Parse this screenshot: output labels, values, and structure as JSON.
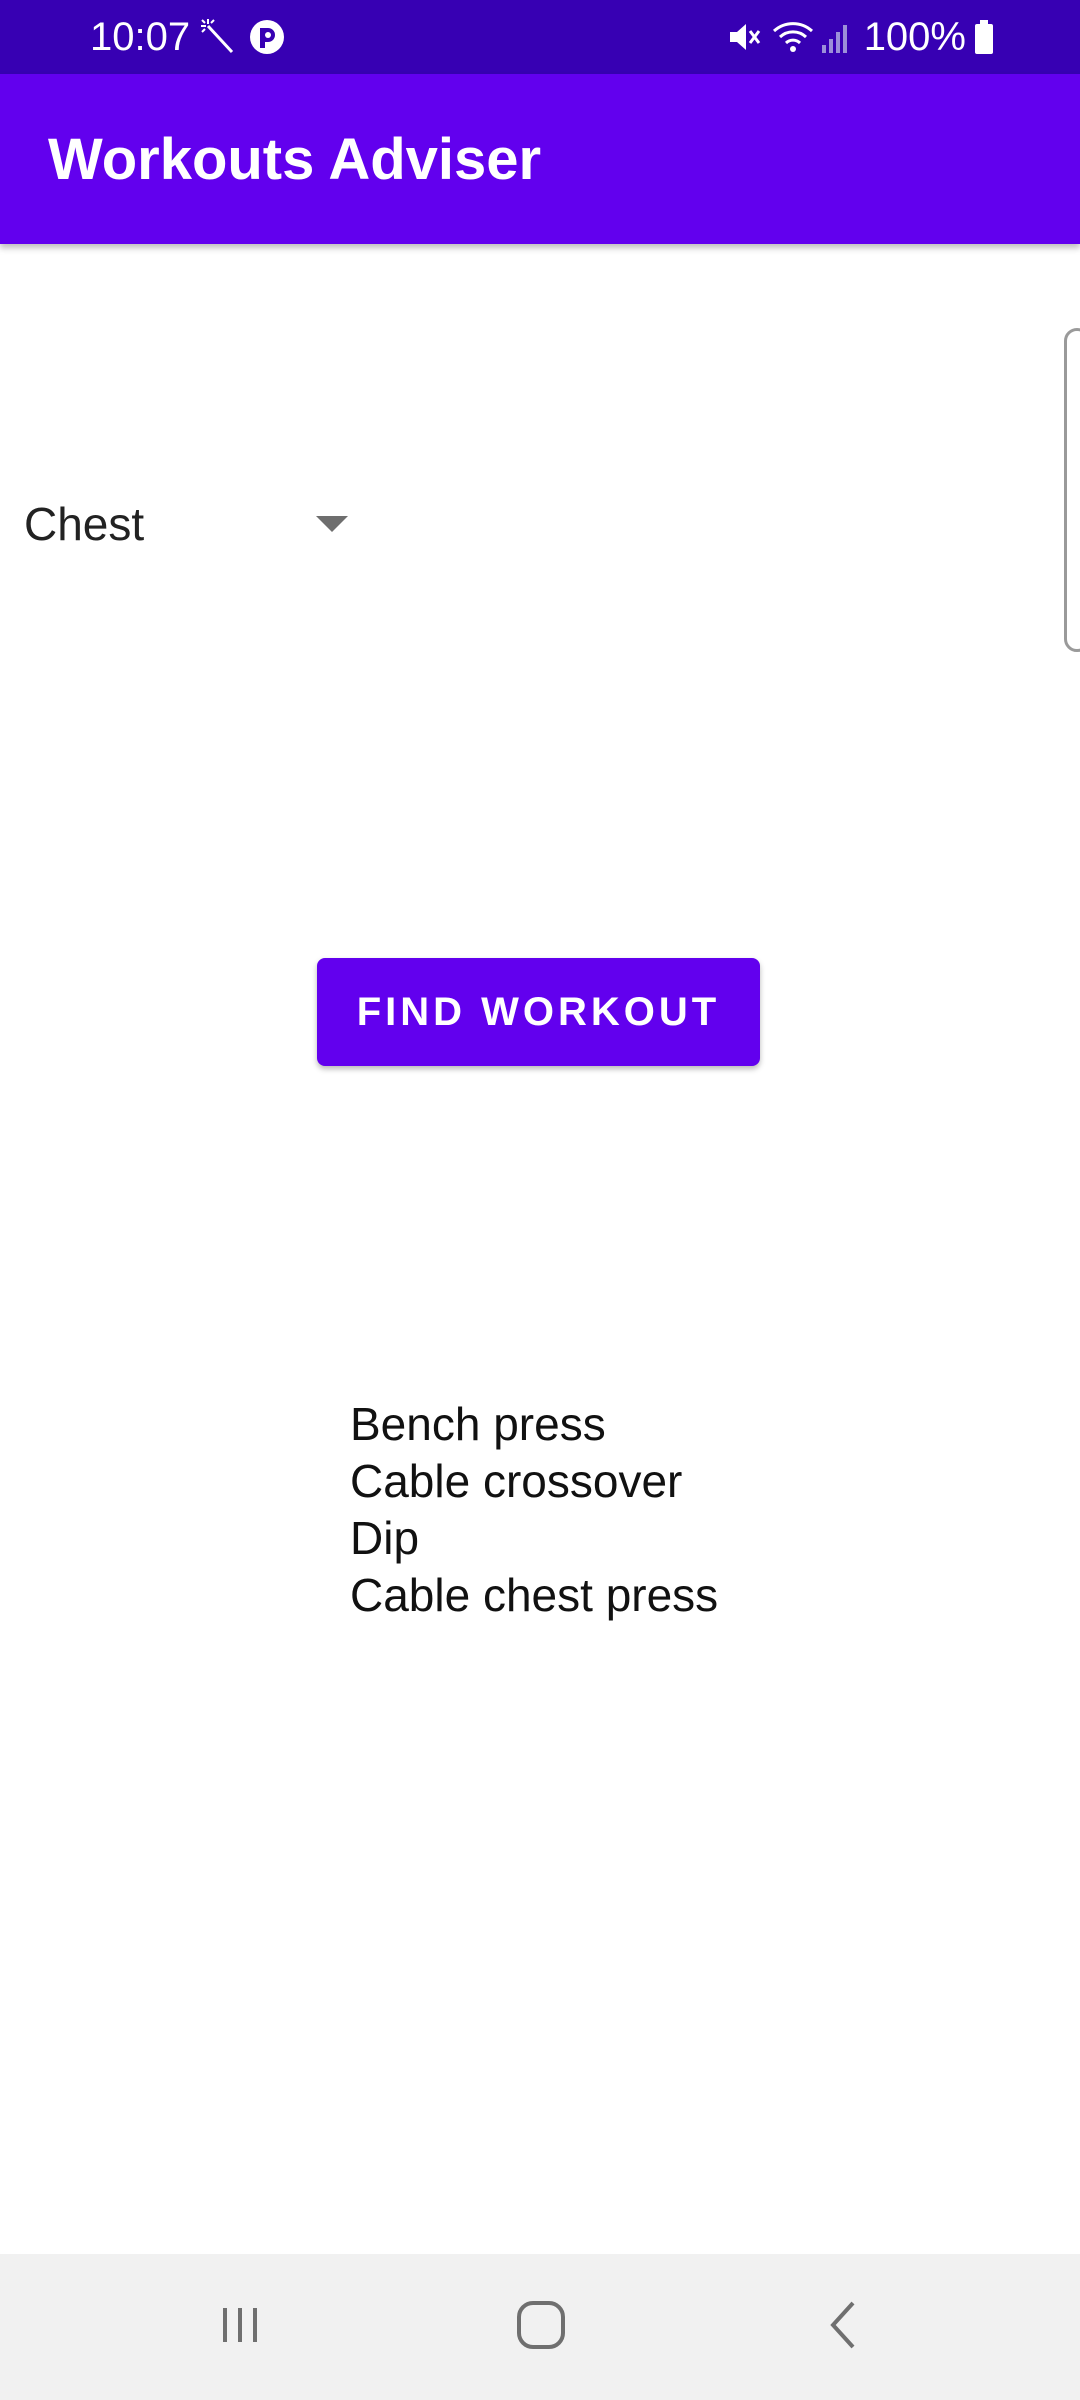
{
  "status_bar": {
    "time": "10:07",
    "battery_percent": "100%",
    "icons": [
      "magic-wand-icon",
      "app-notification-icon",
      "mute-icon",
      "wifi-icon",
      "signal-icon",
      "battery-icon"
    ]
  },
  "app_bar": {
    "title": "Workouts Adviser",
    "color": "#6200ee",
    "status_color": "#3700b3"
  },
  "spinner": {
    "selected": "Chest"
  },
  "find_button": {
    "label": "FIND WORKOUT"
  },
  "results": [
    "Bench press",
    "Cable crossover",
    "Dip",
    "Cable chest press"
  ],
  "nav_bar": {
    "icons": [
      "recents-icon",
      "home-icon",
      "back-icon"
    ]
  }
}
